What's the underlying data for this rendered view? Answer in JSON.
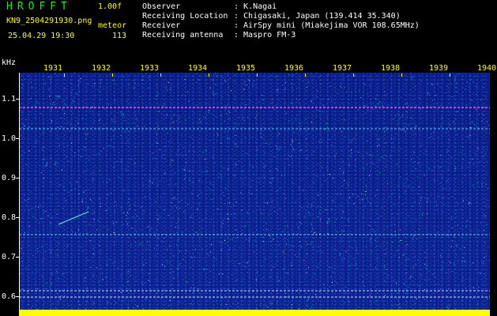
{
  "header": {
    "app_name": "HROFFT",
    "version": "1.00f",
    "filename": "KN9_2504291930.png",
    "datetime": "25.04.29 19:30",
    "meteor_label": "meteor",
    "meteor_count": "113",
    "observer_label": "Observer",
    "observer_value": ": K.Nagai",
    "location_label": "Receiving Location",
    "location_value": ": Chigasaki, Japan (139.414 35.340)",
    "receiver_label": "Receiver",
    "receiver_value": ": AirSpy mini (Miakejima VOR 108.65MHz)",
    "antenna_label": "Receiving antenna",
    "antenna_value": ": Maspro FM-3"
  },
  "axes": {
    "y_unit": "kHz",
    "y_ticks": [
      "1.1",
      "1.0",
      "0.9",
      "0.8",
      "0.7",
      "0.6"
    ],
    "x_ticks": [
      "1931",
      "1932",
      "1933",
      "1934",
      "1935",
      "1936",
      "1937",
      "1938",
      "1939",
      "1940"
    ]
  },
  "colors": {
    "background": "#000000",
    "plot_blue": "#0c1f95",
    "noise_cyan": "#00ffff",
    "label_yellow": "#ffff00",
    "title_green": "#00ff00"
  }
}
